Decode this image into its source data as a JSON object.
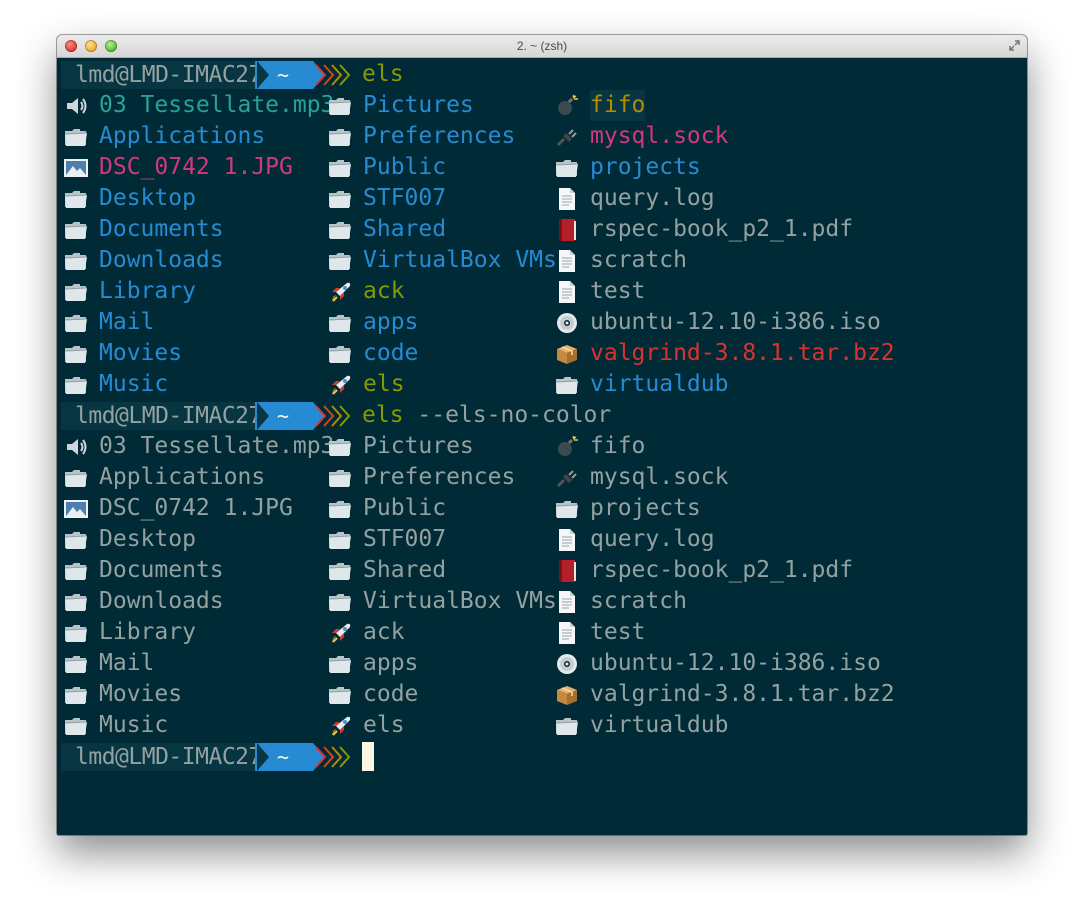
{
  "window": {
    "title": "2. ~ (zsh)"
  },
  "prompt": {
    "host": "lmd@LMD-IMAC27",
    "dir": "~"
  },
  "commands": [
    "els",
    "els --els-no-color",
    ""
  ],
  "listing_color": {
    "col1": [
      {
        "name": "03 Tessellate.mp3",
        "icon": "speaker-icon",
        "color": "cyan"
      },
      {
        "name": "Applications",
        "icon": "folder-icon",
        "color": "blue"
      },
      {
        "name": "DSC_0742 1.JPG",
        "icon": "image-icon",
        "color": "magenta"
      },
      {
        "name": "Desktop",
        "icon": "folder-icon",
        "color": "blue"
      },
      {
        "name": "Documents",
        "icon": "folder-icon",
        "color": "blue"
      },
      {
        "name": "Downloads",
        "icon": "folder-icon",
        "color": "blue"
      },
      {
        "name": "Library",
        "icon": "folder-icon",
        "color": "blue"
      },
      {
        "name": "Mail",
        "icon": "folder-icon",
        "color": "blue"
      },
      {
        "name": "Movies",
        "icon": "folder-icon",
        "color": "blue"
      },
      {
        "name": "Music",
        "icon": "folder-icon",
        "color": "blue"
      }
    ],
    "col2": [
      {
        "name": "Pictures",
        "icon": "folder-icon",
        "color": "blue"
      },
      {
        "name": "Preferences",
        "icon": "folder-icon",
        "color": "blue"
      },
      {
        "name": "Public",
        "icon": "folder-icon",
        "color": "blue"
      },
      {
        "name": "STF007",
        "icon": "folder-icon",
        "color": "blue"
      },
      {
        "name": "Shared",
        "icon": "folder-icon",
        "color": "blue"
      },
      {
        "name": "VirtualBox VMs",
        "icon": "folder-icon",
        "color": "blue"
      },
      {
        "name": "ack",
        "icon": "rocket-icon",
        "color": "green"
      },
      {
        "name": "apps",
        "icon": "folder-icon",
        "color": "blue"
      },
      {
        "name": "code",
        "icon": "folder-icon",
        "color": "blue"
      },
      {
        "name": "els",
        "icon": "rocket-icon",
        "color": "green"
      }
    ],
    "col3": [
      {
        "name": "fifo",
        "icon": "bomb-icon",
        "color": "yellow"
      },
      {
        "name": "mysql.sock",
        "icon": "plug-icon",
        "color": "magenta"
      },
      {
        "name": "projects",
        "icon": "folder-icon",
        "color": "blue"
      },
      {
        "name": "query.log",
        "icon": "document-icon",
        "color": "gray"
      },
      {
        "name": "rspec-book_p2_1.pdf",
        "icon": "book-icon",
        "color": "gray"
      },
      {
        "name": "scratch",
        "icon": "document-icon",
        "color": "gray"
      },
      {
        "name": "test",
        "icon": "document-icon",
        "color": "gray"
      },
      {
        "name": "ubuntu-12.10-i386.iso",
        "icon": "disc-icon",
        "color": "gray"
      },
      {
        "name": "valgrind-3.8.1.tar.bz2",
        "icon": "package-icon",
        "color": "red"
      },
      {
        "name": "virtualdub",
        "icon": "folder-icon",
        "color": "blue"
      }
    ]
  },
  "listing_plain": {
    "col1": [
      "03 Tessellate.mp3",
      "Applications",
      "DSC_0742 1.JPG",
      "Desktop",
      "Documents",
      "Downloads",
      "Library",
      "Mail",
      "Movies",
      "Music"
    ],
    "col2": [
      "Pictures",
      "Preferences",
      "Public",
      "STF007",
      "Shared",
      "VirtualBox VMs",
      "ack",
      "apps",
      "code",
      "els"
    ],
    "col3": [
      "fifo",
      "mysql.sock",
      "projects",
      "query.log",
      "rspec-book_p2_1.pdf",
      "scratch",
      "test",
      "ubuntu-12.10-i386.iso",
      "valgrind-3.8.1.tar.bz2",
      "virtualdub"
    ]
  },
  "colors": {
    "background": "#002b36",
    "blue": "#268bd2",
    "cyan": "#2aa198",
    "magenta": "#d33682",
    "yellow": "#b58900",
    "green": "#859900",
    "red": "#dc322f",
    "gray": "#93a1a1"
  }
}
